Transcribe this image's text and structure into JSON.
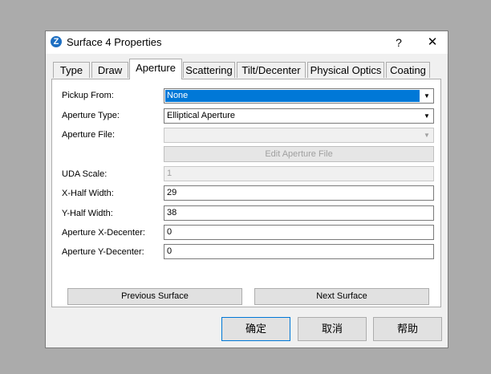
{
  "window": {
    "title": "Surface 4 Properties",
    "app_icon_letter": "Z",
    "help_label": "?",
    "close_label": "✕"
  },
  "tabs": [
    {
      "label": "Type",
      "active": false
    },
    {
      "label": "Draw",
      "active": false
    },
    {
      "label": "Aperture",
      "active": true
    },
    {
      "label": "Scattering",
      "active": false
    },
    {
      "label": "Tilt/Decenter",
      "active": false
    },
    {
      "label": "Physical Optics",
      "active": false
    },
    {
      "label": "Coating",
      "active": false
    }
  ],
  "aperture": {
    "pickup_from": {
      "label": "Pickup From:",
      "value": "None"
    },
    "aperture_type": {
      "label": "Aperture Type:",
      "value": "Elliptical Aperture"
    },
    "aperture_file": {
      "label": "Aperture File:",
      "value": ""
    },
    "edit_aperture_file_label": "Edit Aperture File",
    "uda_scale": {
      "label": "UDA Scale:",
      "value": "1"
    },
    "x_half_width": {
      "label": "X-Half Width:",
      "value": "29"
    },
    "y_half_width": {
      "label": "Y-Half Width:",
      "value": "38"
    },
    "x_decenter": {
      "label": "Aperture X-Decenter:",
      "value": "0"
    },
    "y_decenter": {
      "label": "Aperture Y-Decenter:",
      "value": "0"
    }
  },
  "nav": {
    "previous_label": "Previous Surface",
    "next_label": "Next Surface"
  },
  "buttons": {
    "ok_label": "确定",
    "cancel_label": "取消",
    "help_label": "帮助"
  },
  "icons": {
    "dropdown": "chevron-down-icon",
    "help": "help-icon",
    "close": "close-icon",
    "app": "zemax-app-icon"
  },
  "colors": {
    "selection": "#0078d7",
    "panel": "#ffffff",
    "dialog": "#f0f0f0",
    "desktop": "#ababab"
  }
}
